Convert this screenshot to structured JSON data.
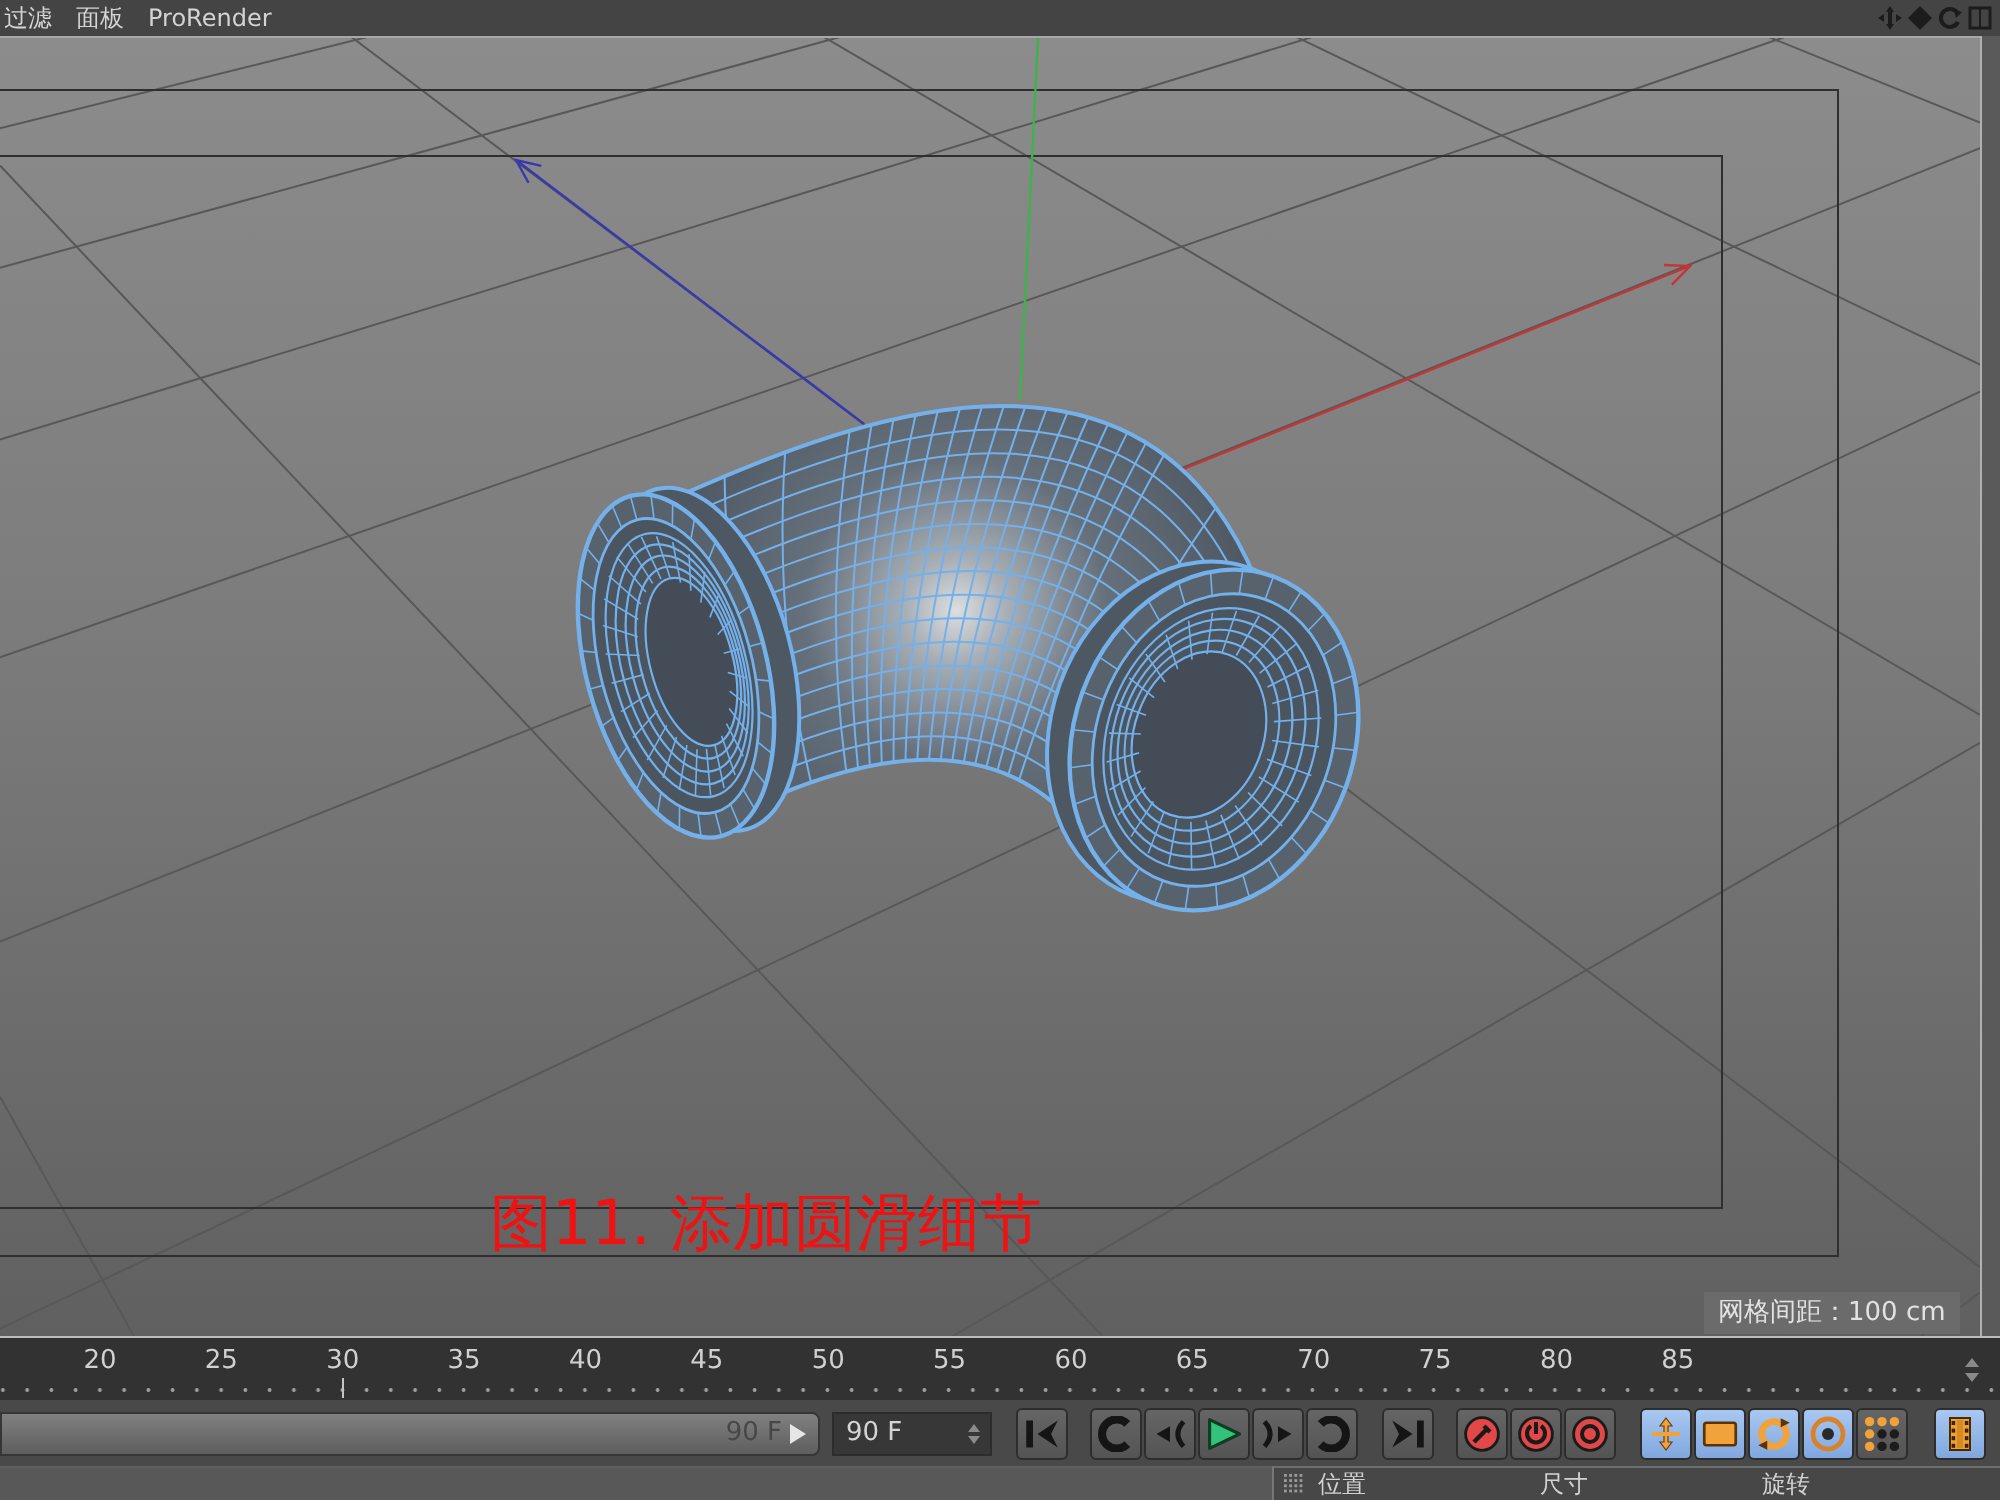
{
  "menu_bar": {
    "items": [
      "过滤",
      "面板",
      "ProRender"
    ]
  },
  "viewport": {
    "caption": "图11. 添加圆滑细节",
    "grid_spacing": "网格间距：100 cm"
  },
  "timeline": {
    "ticks": [
      {
        "label": "20",
        "current": false
      },
      {
        "label": "25",
        "current": false
      },
      {
        "label": "30",
        "current": true
      },
      {
        "label": "35",
        "current": false
      },
      {
        "label": "40",
        "current": false
      },
      {
        "label": "45",
        "current": false
      },
      {
        "label": "50",
        "current": false
      },
      {
        "label": "55",
        "current": false
      },
      {
        "label": "60",
        "current": false
      },
      {
        "label": "65",
        "current": false
      },
      {
        "label": "70",
        "current": false
      },
      {
        "label": "75",
        "current": false
      },
      {
        "label": "80",
        "current": false
      },
      {
        "label": "85",
        "current": false
      }
    ]
  },
  "range_bar": {
    "end_label": "90 F"
  },
  "end_frame_field": {
    "value": "90 F"
  },
  "key_toggles": [
    {
      "kind": "move",
      "on": true
    },
    {
      "kind": "scale",
      "on": true
    },
    {
      "kind": "rotate",
      "on": true
    },
    {
      "kind": "parameter",
      "on": true
    },
    {
      "kind": "point-level",
      "on": false
    }
  ],
  "film_toggle": {
    "on": true
  },
  "attributes_panel": {
    "columns": [
      "位置",
      "尺寸",
      "旋转"
    ]
  }
}
